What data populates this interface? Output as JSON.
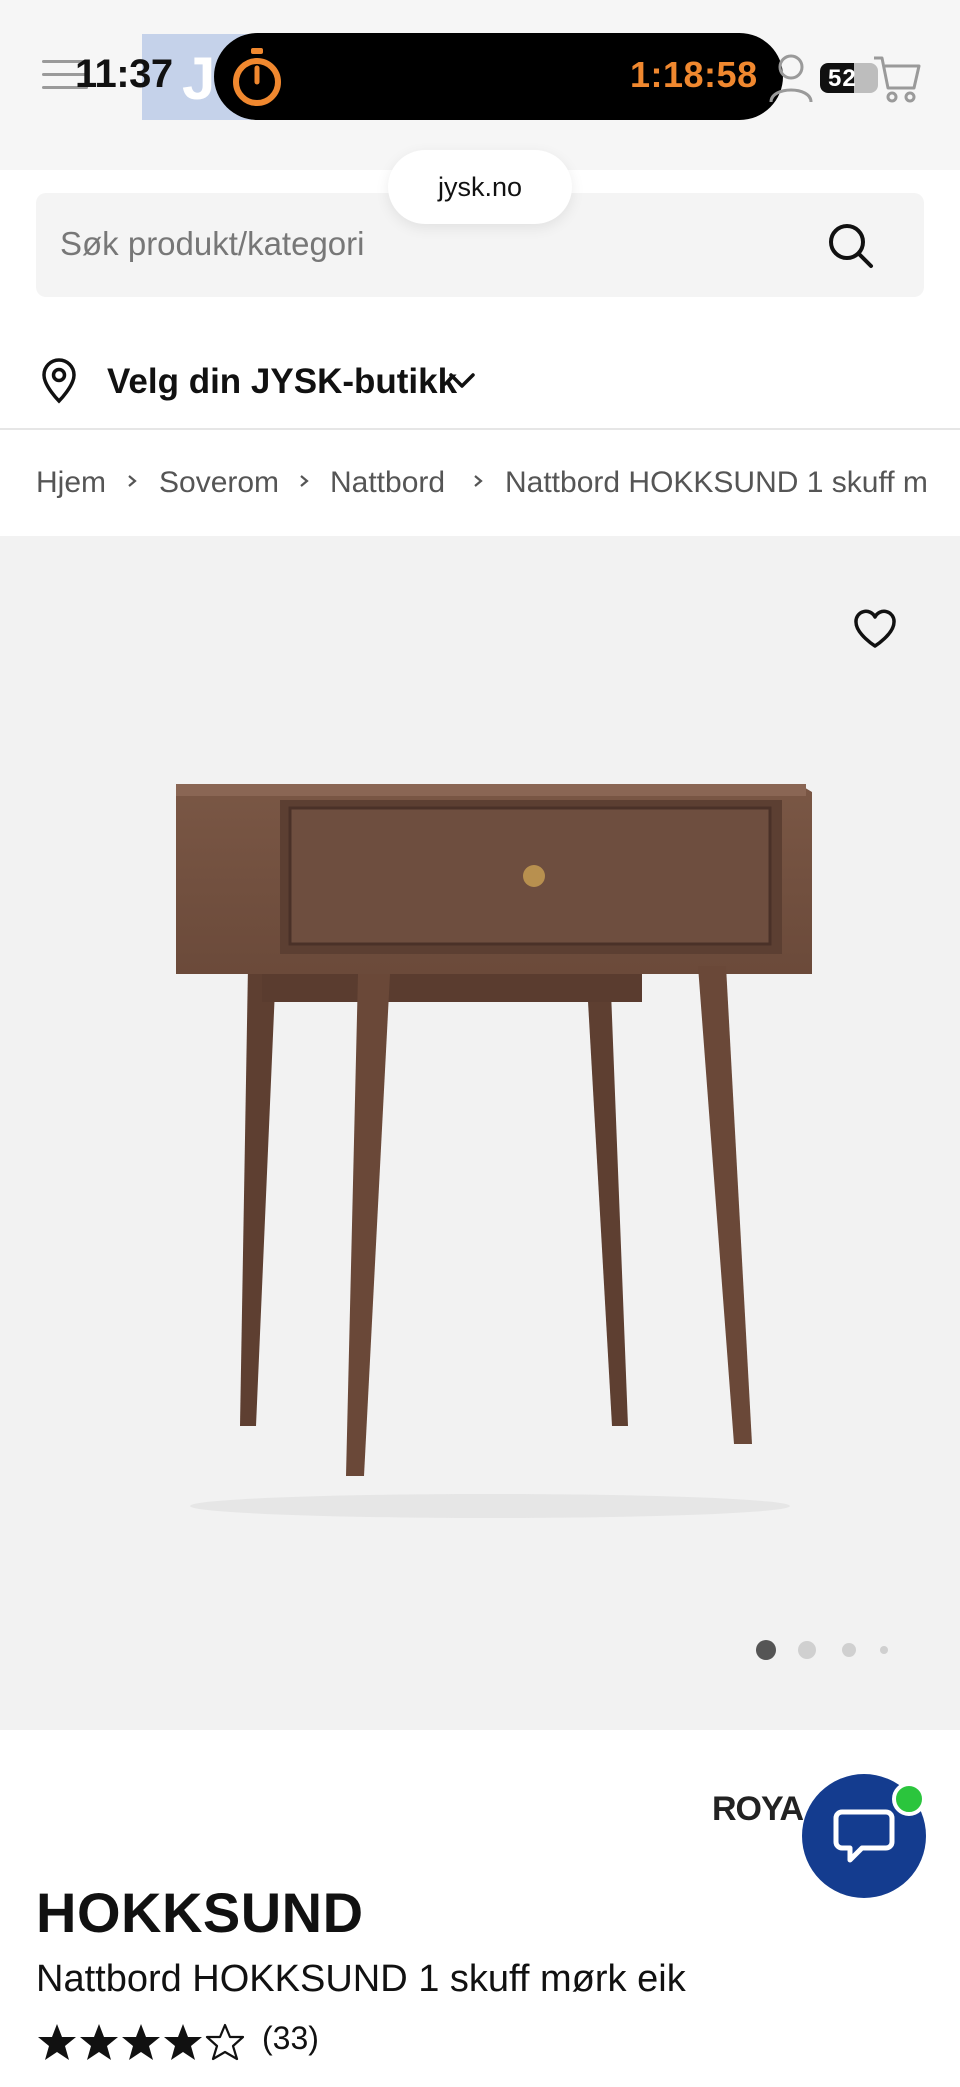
{
  "status_bar": {
    "time": "11:37",
    "timer": "1:18:58",
    "badge_count": "52",
    "url": "jysk.no"
  },
  "header": {
    "logo_letter": "J",
    "search_placeholder": "Søk produkt/kategori"
  },
  "store_selector": {
    "label": "Velg din JYSK-butikk"
  },
  "breadcrumb": {
    "items": [
      "Hjem",
      "Soverom",
      "Nattbord",
      "Nattbord HOKKSUND 1 skuff m"
    ]
  },
  "gallery": {
    "slide_count": 4,
    "active_slide": 1
  },
  "product": {
    "brand_logo_text": "ROYA",
    "brand": "HOKKSUND",
    "name": "Nattbord HOKKSUND 1 skuff mørk eik",
    "rating": 4,
    "rating_max": 5,
    "review_count": "(33)"
  },
  "colors": {
    "accent_orange": "#f0882f",
    "chat_blue": "#143c8f",
    "online_green": "#2bc53d",
    "wood": "#6b4a3a"
  }
}
